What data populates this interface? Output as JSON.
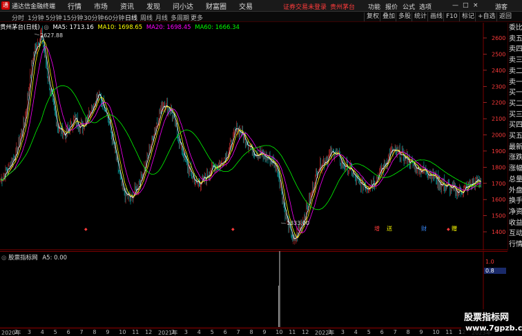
{
  "titlebar": {
    "logo": "通",
    "title": "通达信金融终端",
    "menus": [
      "行情",
      "市场",
      "资讯",
      "发现",
      "问小达",
      "财富圈",
      "交易"
    ],
    "login_warning": "证券交易未登录",
    "stock_name": "贵州茅台",
    "right_items": [
      "功能",
      "报价",
      "公式",
      "选项"
    ],
    "guest": "游客",
    "minimize": "—",
    "maximize": "□",
    "close": "×"
  },
  "toolbar": {
    "periods": [
      "分时",
      "1分钟",
      "5分钟",
      "15分钟",
      "30分钟",
      "60分钟",
      "日线",
      "周线",
      "月线",
      "多周期",
      "更多"
    ],
    "active_period": "日线",
    "right_buttons": [
      "复权",
      "叠加",
      "多股",
      "统计",
      "画线",
      "F10",
      "标记",
      "+自选",
      "返回"
    ]
  },
  "chart_header": {
    "stock_label": "贵州茅台(日线)",
    "ma5": "MA5: 1713.16",
    "ma10": "MA10: 1698.65",
    "ma20": "MA20: 1698.45",
    "ma60": "MA60: 1666.34"
  },
  "price_axis": [
    "2600",
    "2500",
    "2400",
    "2300",
    "2200",
    "2100",
    "2000",
    "1900",
    "1800",
    "1700",
    "1600",
    "1500",
    "1400"
  ],
  "annotations": {
    "high": "2627.88",
    "low": "1333.00"
  },
  "event_markers": [
    "增",
    "送",
    "财",
    "赠"
  ],
  "side_panel": [
    "委比",
    "卖五",
    "卖四",
    "卖三",
    "卖二",
    "卖一",
    "买一",
    "买二",
    "买三",
    "买四",
    "买五",
    "最新",
    "涨跌",
    "涨幅",
    "总量",
    "外盘",
    "换手",
    "净资",
    "收益",
    "互动",
    "行情"
  ],
  "sub_chart": {
    "header": "股票指标网",
    "value_label": "A5: 0.00",
    "axis_top": "1.0",
    "axis_current": "0.8"
  },
  "date_axis": [
    "2020年",
    "2",
    "3",
    "4",
    "5",
    "6",
    "7",
    "8",
    "9",
    "10",
    "11",
    "12",
    "2021年",
    "2",
    "3",
    "4",
    "5",
    "6",
    "7",
    "8",
    "9",
    "10",
    "11",
    "12",
    "2022年",
    "2",
    "3",
    "4",
    "5",
    "6",
    "7",
    "8",
    "9",
    "10",
    "11",
    "12",
    "2023年"
  ],
  "watermark": {
    "line1": "股票指标网",
    "line2": "www.7gpzb.com"
  },
  "colors": {
    "up": "#ff3b3b",
    "down": "#00e5e5",
    "ma5": "#ffffff",
    "ma10": "#ffff00",
    "ma20": "#ff00ff",
    "ma60": "#00ff00",
    "grid_red": "#7a0000",
    "axis_label": "#ff3b3b"
  },
  "chart_data": {
    "type": "line",
    "title": "贵州茅台(日线)",
    "ylim": [
      1300,
      2700
    ],
    "series": [
      {
        "name": "MA5",
        "values": [
          1713.16
        ]
      },
      {
        "name": "MA10",
        "values": [
          1698.65
        ]
      },
      {
        "name": "MA20",
        "values": [
          1698.45
        ]
      },
      {
        "name": "MA60",
        "values": [
          1666.34
        ]
      }
    ],
    "high": 2627.88,
    "low": 1333.0,
    "price_path": [
      1720,
      1800,
      1900,
      2100,
      2500,
      2627.88,
      2300,
      2050,
      2000,
      2100,
      2050,
      2150,
      2250,
      2150,
      1900,
      1650,
      1600,
      1700,
      1850,
      2050,
      2200,
      2150,
      1950,
      1800,
      1700,
      1720,
      1800,
      1820,
      1900,
      2050,
      1980,
      1900,
      1880,
      1850,
      1800,
      1500,
      1333.0,
      1450,
      1600,
      1800,
      1850,
      1900,
      1820,
      1780,
      1700,
      1680,
      1720,
      1800,
      1900,
      1880,
      1850,
      1800,
      1780,
      1760,
      1700,
      1680,
      1650,
      1660,
      1700,
      1720
    ]
  }
}
